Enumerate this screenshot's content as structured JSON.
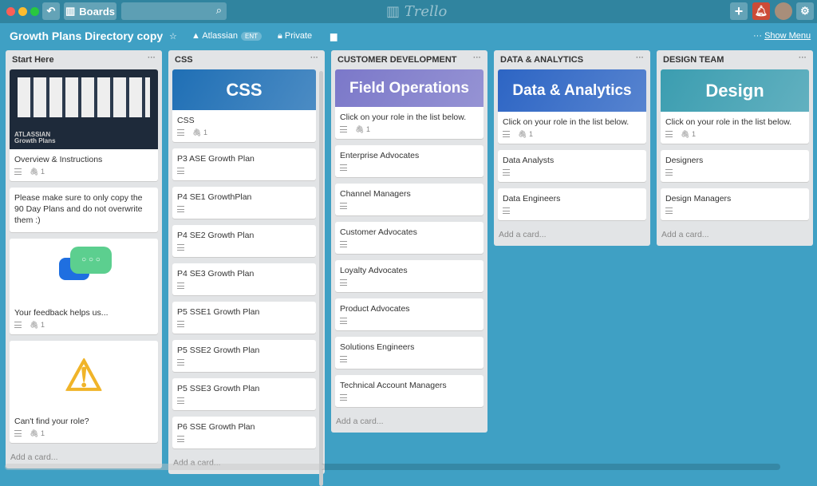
{
  "topbar": {
    "boards_label": "Boards",
    "search_placeholder": "",
    "logo": "Trello",
    "colors": {
      "bar": "#30849f",
      "notification": "#cc4b37"
    }
  },
  "board": {
    "title": "Growth Plans Directory copy",
    "team": "Atlassian",
    "team_badge": "ENT",
    "visibility": "Private",
    "show_menu": "Show Menu",
    "menu_dots": "···",
    "background": "#3fa0c4"
  },
  "lists": [
    {
      "title": "Start Here",
      "add_card": "Add a card...",
      "cards": [
        {
          "title": "Overview & Instructions",
          "cover": {
            "type": "video",
            "text": "ATLASSIAN Growth Plans"
          },
          "desc": true,
          "attachments": "1"
        },
        {
          "title": "Please make sure to only copy the 90 Day Plans and do not overwrite them :)",
          "desc": false
        },
        {
          "title": "Your feedback helps us...",
          "cover": {
            "type": "chat-icon"
          },
          "desc": true,
          "attachments": "1"
        },
        {
          "title": "Can't find your role?",
          "cover": {
            "type": "warning-icon"
          },
          "desc": true,
          "attachments": "1"
        }
      ]
    },
    {
      "title": "CSS",
      "add_card": "Add a card...",
      "cards": [
        {
          "title": "CSS",
          "cover": {
            "type": "banner",
            "text": "CSS",
            "color": "#1f6fb5"
          },
          "desc": true,
          "attachments": "1"
        },
        {
          "title": "P3 ASE Growth Plan",
          "desc": true
        },
        {
          "title": "P4 SE1 GrowthPlan",
          "desc": true
        },
        {
          "title": "P4 SE2 Growth Plan",
          "desc": true
        },
        {
          "title": "P4 SE3 Growth Plan",
          "desc": true
        },
        {
          "title": "P5 SSE1 Growth Plan",
          "desc": true
        },
        {
          "title": "P5 SSE2 Growth Plan",
          "desc": true
        },
        {
          "title": "P5 SSE3 Growth Plan",
          "desc": true
        },
        {
          "title": "P6 SSE Growth Plan",
          "desc": true
        }
      ]
    },
    {
      "title": "CUSTOMER DEVELOPMENT",
      "add_card": "Add a card...",
      "cards": [
        {
          "title": "Click on your role in the list below.",
          "cover": {
            "type": "banner",
            "text": "Field Operations",
            "color": "#7b78c9"
          },
          "desc": true,
          "attachments": "1"
        },
        {
          "title": "Enterprise Advocates",
          "desc": true
        },
        {
          "title": "Channel Managers",
          "desc": true
        },
        {
          "title": "Customer Advocates",
          "desc": true
        },
        {
          "title": "Loyalty Advocates",
          "desc": true
        },
        {
          "title": "Product Advocates",
          "desc": true
        },
        {
          "title": "Solutions Engineers",
          "desc": true
        },
        {
          "title": "Technical Account Managers",
          "desc": true
        }
      ]
    },
    {
      "title": "DATA & ANALYTICS",
      "add_card": "Add a card...",
      "cards": [
        {
          "title": "Click on your role in the list below.",
          "cover": {
            "type": "banner",
            "text": "Data & Analytics",
            "color": "#2d65c4"
          },
          "desc": true,
          "attachments": "1"
        },
        {
          "title": "Data Analysts",
          "desc": true
        },
        {
          "title": "Data Engineers",
          "desc": true
        }
      ]
    },
    {
      "title": "DESIGN TEAM",
      "add_card": "Add a card...",
      "cards": [
        {
          "title": "Click on your role in the list below.",
          "cover": {
            "type": "banner",
            "text": "Design",
            "color": "#3b9db0"
          },
          "desc": true,
          "attachments": "1"
        },
        {
          "title": "Designers",
          "desc": true
        },
        {
          "title": "Design Managers",
          "desc": true
        }
      ]
    }
  ]
}
